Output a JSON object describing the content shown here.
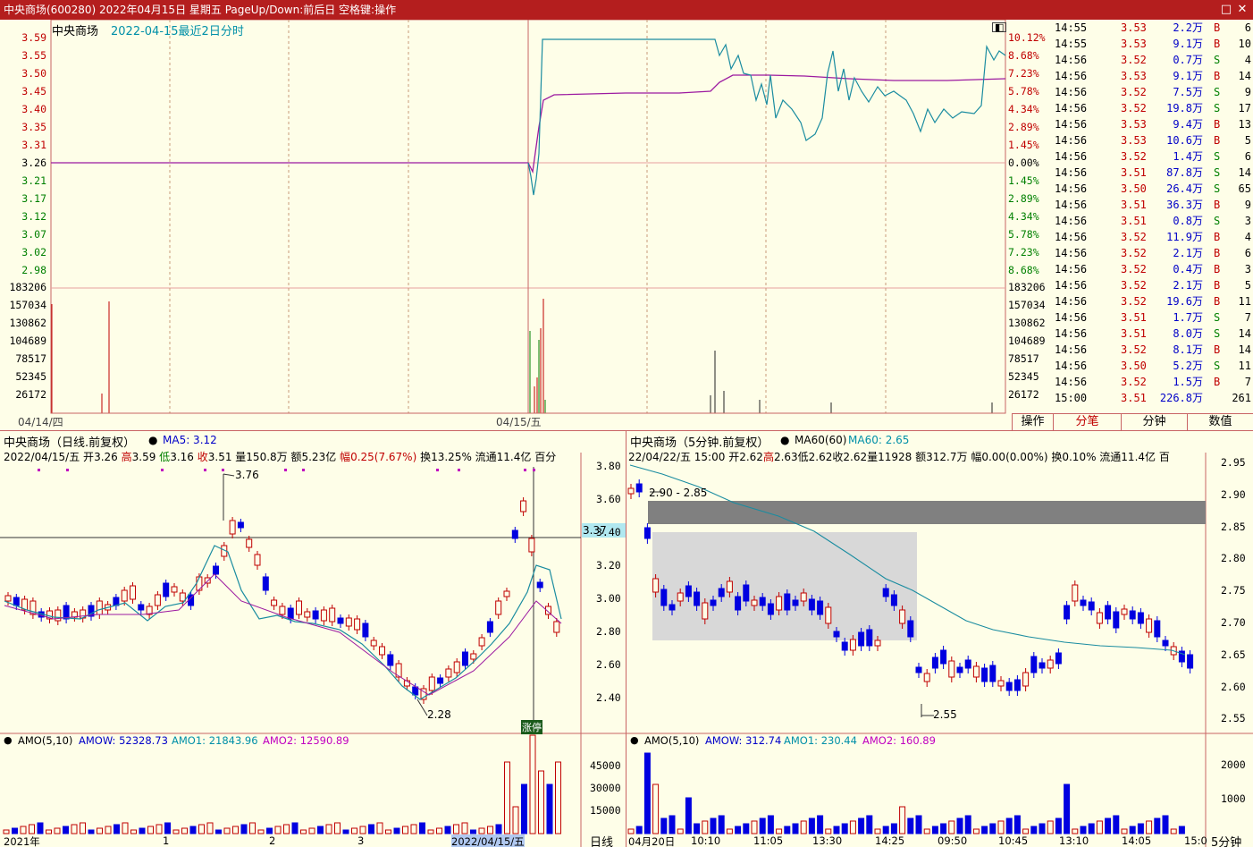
{
  "window": {
    "title": "中央商场(600280) 2022年04月15日 星期五 PageUp/Down:前后日 空格键:操作",
    "restore_btn": "□",
    "close_btn": "✕"
  },
  "intraday": {
    "name": "中央商场",
    "subtitle": "2022-04-15最近2日分时",
    "price_ticks": [
      "3.59",
      "3.55",
      "3.50",
      "3.45",
      "3.40",
      "3.35",
      "3.31",
      "3.26",
      "3.21",
      "3.17",
      "3.12",
      "3.07",
      "3.02",
      "2.98"
    ],
    "pct_ticks": [
      "10.12%",
      "8.68%",
      "7.23%",
      "5.78%",
      "4.34%",
      "2.89%",
      "1.45%",
      "0.00%",
      "1.45%",
      "2.89%",
      "4.34%",
      "5.78%",
      "7.23%",
      "8.68%"
    ],
    "vol_ticks": [
      "183206",
      "157034",
      "130862",
      "104689",
      "78517",
      "52345",
      "26172"
    ],
    "dates": [
      "04/14/四",
      "04/15/五"
    ]
  },
  "ticks": [
    {
      "t": "14:55",
      "p": "3.53",
      "v": "2.2万",
      "s": "B",
      "n": "6"
    },
    {
      "t": "14:55",
      "p": "3.53",
      "v": "9.1万",
      "s": "B",
      "n": "10"
    },
    {
      "t": "14:56",
      "p": "3.52",
      "v": "0.7万",
      "s": "S",
      "n": "4"
    },
    {
      "t": "14:56",
      "p": "3.53",
      "v": "9.1万",
      "s": "B",
      "n": "14"
    },
    {
      "t": "14:56",
      "p": "3.52",
      "v": "7.5万",
      "s": "S",
      "n": "9"
    },
    {
      "t": "14:56",
      "p": "3.52",
      "v": "19.8万",
      "s": "S",
      "n": "17"
    },
    {
      "t": "14:56",
      "p": "3.53",
      "v": "9.4万",
      "s": "B",
      "n": "13"
    },
    {
      "t": "14:56",
      "p": "3.53",
      "v": "10.6万",
      "s": "B",
      "n": "5"
    },
    {
      "t": "14:56",
      "p": "3.52",
      "v": "1.4万",
      "s": "S",
      "n": "6"
    },
    {
      "t": "14:56",
      "p": "3.51",
      "v": "87.8万",
      "s": "S",
      "n": "14"
    },
    {
      "t": "14:56",
      "p": "3.50",
      "v": "26.4万",
      "s": "S",
      "n": "65"
    },
    {
      "t": "14:56",
      "p": "3.51",
      "v": "36.3万",
      "s": "B",
      "n": "9"
    },
    {
      "t": "14:56",
      "p": "3.51",
      "v": "0.8万",
      "s": "S",
      "n": "3"
    },
    {
      "t": "14:56",
      "p": "3.52",
      "v": "11.9万",
      "s": "B",
      "n": "4"
    },
    {
      "t": "14:56",
      "p": "3.52",
      "v": "2.1万",
      "s": "B",
      "n": "6"
    },
    {
      "t": "14:56",
      "p": "3.52",
      "v": "0.4万",
      "s": "B",
      "n": "3"
    },
    {
      "t": "14:56",
      "p": "3.52",
      "v": "2.1万",
      "s": "B",
      "n": "5"
    },
    {
      "t": "14:56",
      "p": "3.52",
      "v": "19.6万",
      "s": "B",
      "n": "11"
    },
    {
      "t": "14:56",
      "p": "3.51",
      "v": "1.7万",
      "s": "S",
      "n": "7"
    },
    {
      "t": "14:56",
      "p": "3.51",
      "v": "8.0万",
      "s": "S",
      "n": "14"
    },
    {
      "t": "14:56",
      "p": "3.52",
      "v": "8.1万",
      "s": "B",
      "n": "14"
    },
    {
      "t": "14:56",
      "p": "3.50",
      "v": "5.2万",
      "s": "S",
      "n": "11"
    },
    {
      "t": "14:56",
      "p": "3.52",
      "v": "1.5万",
      "s": "B",
      "n": "7"
    },
    {
      "t": "15:00",
      "p": "3.51",
      "v": "226.8万",
      "s": "",
      "n": "261"
    }
  ],
  "tabs": {
    "op": "操作",
    "tick": "分笔",
    "minute": "分钟",
    "value": "数值"
  },
  "daily": {
    "header": "中央商场（日线.前复权）",
    "ma_label": "MA5: 3.12",
    "info_date": "2022/04/15/五",
    "info_open_lbl": "开",
    "info_open": "3.26",
    "info_high_lbl": "高",
    "info_high": "3.59",
    "info_low_lbl": "低",
    "info_low": "3.16",
    "info_close_lbl": "收",
    "info_close": "3.51",
    "info_vol": "量150.8万",
    "info_amt": "额5.23亿",
    "info_range_lbl": "幅",
    "info_range": "0.25(7.67%)",
    "info_rest": "换13.25% 流通11.4亿 百分",
    "price_ticks": [
      "3.80",
      "3.60",
      "3.40",
      "3.20",
      "3.00",
      "2.80",
      "2.60",
      "2.40"
    ],
    "cursor_price": "3.37",
    "hi_label": "3.76",
    "lo_label": "2.28",
    "marker": "涨停",
    "amo_header": "AMO(5,10)",
    "amo_w": "AMOW: 52328.73",
    "amo_1": "AMO1: 21843.96",
    "amo_2": "AMO2: 12590.89",
    "amo_ticks": [
      "45000",
      "30000",
      "15000"
    ],
    "x_labels": [
      "2021年",
      "1",
      "2",
      "3",
      "2022/04/15/五"
    ],
    "period": "日线"
  },
  "min5": {
    "header": "中央商场（5分钟.前复权）",
    "ma_label": "MA60(60)",
    "ma_value": "MA60: 2.65",
    "info_date": "22/04/22/五",
    "info_time": "15:00",
    "info_open": "开2.62",
    "info_high_lbl": "高",
    "info_high": "2.63",
    "info_low": "低2.62",
    "info_close": "收2.62",
    "info_vol": "量11928",
    "info_amt": "额312.7万",
    "info_rest": "幅0.00(0.00%) 换0.10% 流通11.4亿 百",
    "price_ticks": [
      "2.95",
      "2.90",
      "2.85",
      "2.80",
      "2.75",
      "2.70",
      "2.65",
      "2.60",
      "2.55"
    ],
    "hi_label": "2.90 - 2.85",
    "lo_label": "2.55",
    "amo_header": "AMO(5,10)",
    "amo_w": "AMOW: 312.74",
    "amo_1": "AMO1: 230.44",
    "amo_2": "AMO2: 160.89",
    "amo_ticks": [
      "2000",
      "1000"
    ],
    "x_labels": [
      "04月20日",
      "10:10",
      "11:05",
      "13:30",
      "14:25",
      "09:50",
      "10:45",
      "13:10",
      "14:05",
      "15:0"
    ],
    "period": "5分钟"
  }
}
